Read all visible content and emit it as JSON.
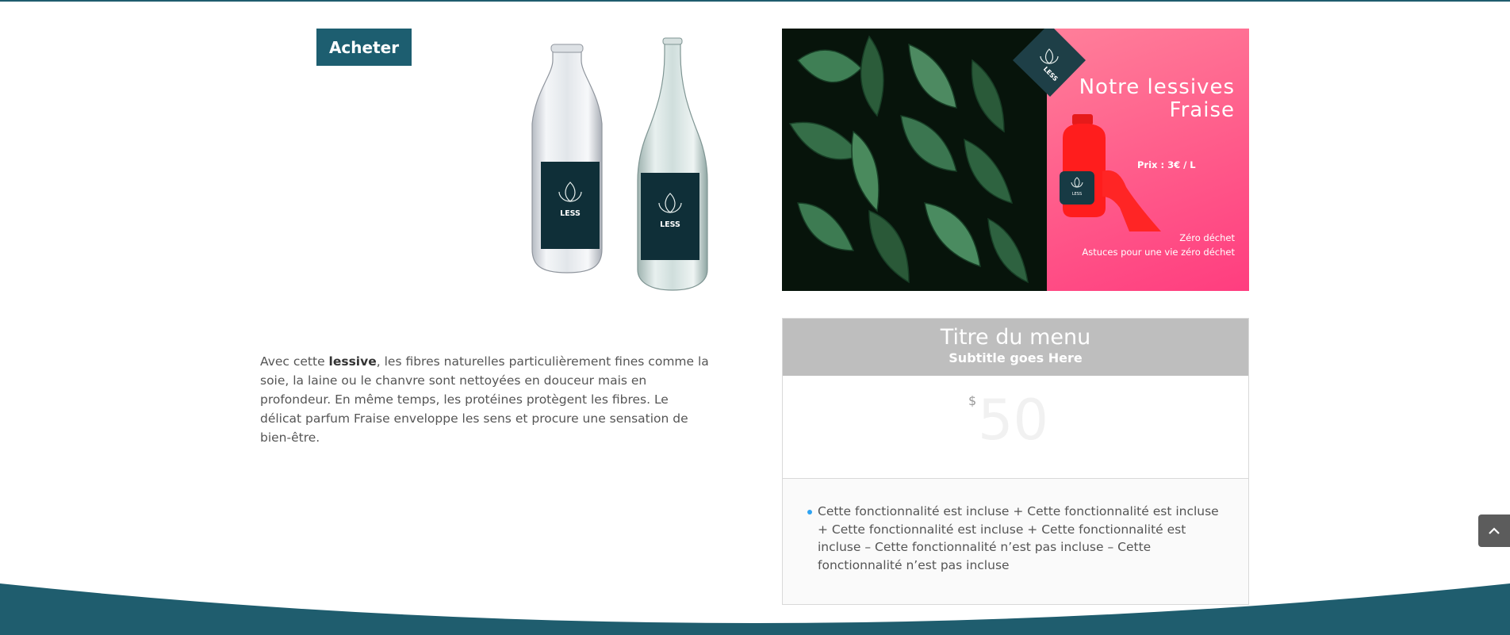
{
  "colors": {
    "brand": "#1d5e70",
    "promo_pink": "#ff5a8a",
    "bullet": "#2ea3f2",
    "pricing_header": "#bebebe"
  },
  "buy_button": {
    "label": "Acheter"
  },
  "bottles": {
    "left_label": "LESS",
    "right_label": "LESS",
    "icon": "leaf-logo-icon"
  },
  "description": {
    "before": "Avec cette ",
    "bold": "lessive",
    "after": ", les fibres naturelles particulièrement fines comme la soie, la laine ou le chanvre sont nettoyées en douceur mais en profondeur. En même temps, les protéines protègent les fibres. Le délicat parfum Fraise enveloppe les sens et procure une sensation de bien-être."
  },
  "promo": {
    "badge": "LESS",
    "title_line1": "Notre  lessives",
    "title_line2": "Fraise",
    "price": "Prix :   3€ / L",
    "zero_waste": "Zéro déchet",
    "tips": "Astuces pour une vie zéro déchet",
    "jug_label": "LESS",
    "icons": [
      "leaves-photo",
      "detergent-jug-icon",
      "leaf-logo-icon"
    ]
  },
  "pricing": {
    "title": "Titre du menu",
    "subtitle": "Subtitle goes Here",
    "currency": "$",
    "amount": "50",
    "features": "Cette fonctionnalité est incluse + Cette fonctionnalité est incluse + Cette fonctionnalité est incluse + Cette fonctionnalité est incluse – Cette fonctionnalité n’est pas incluse – Cette fonctionnalité n’est pas incluse"
  },
  "scroll_top": {
    "icon": "chevron-up-icon"
  }
}
